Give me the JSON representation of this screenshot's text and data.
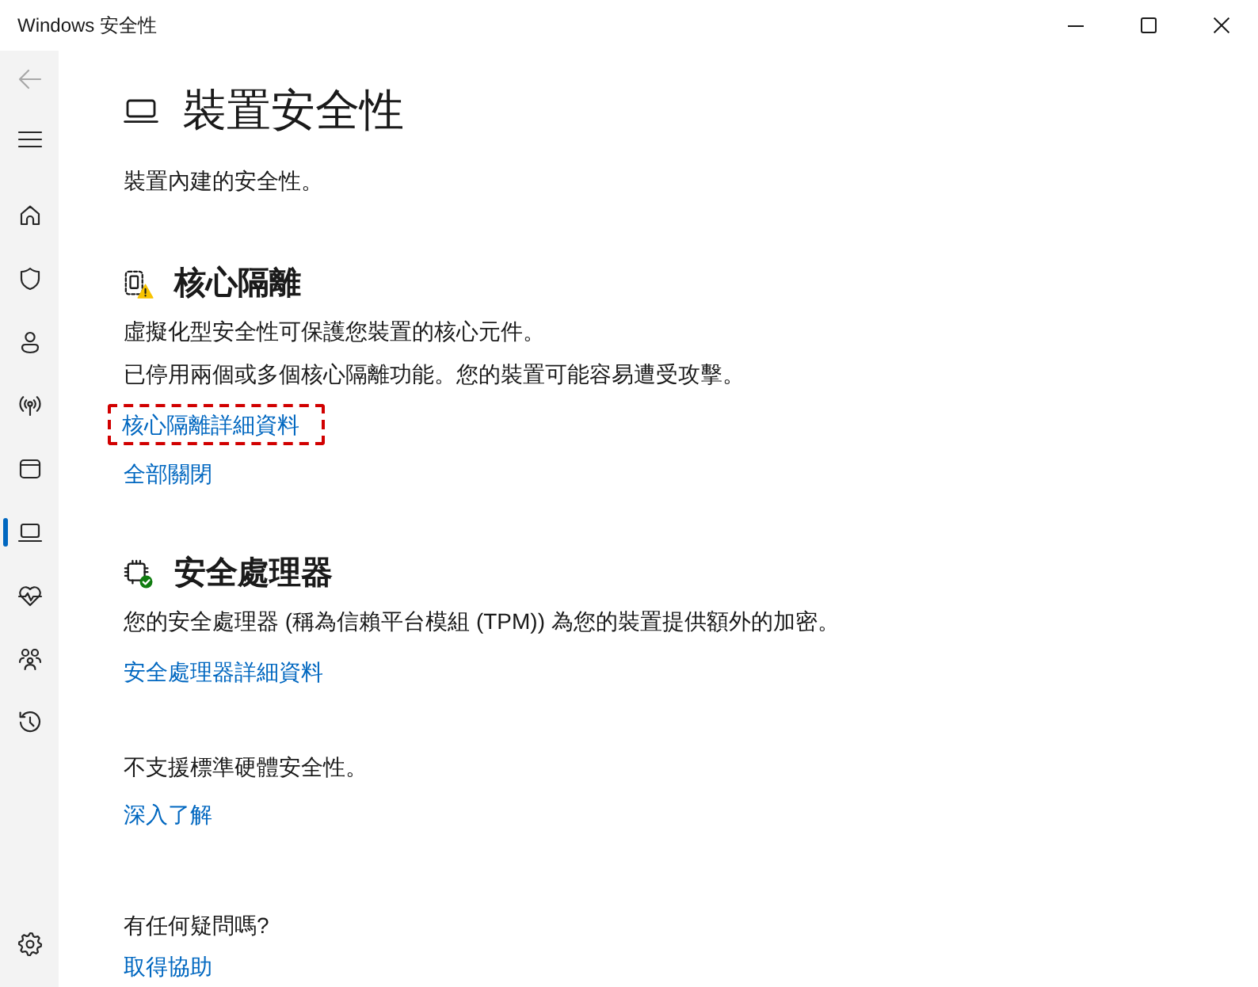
{
  "window": {
    "title": "Windows 安全性"
  },
  "sidebar": {
    "back": {
      "disabled": true
    },
    "nav_items": [
      {
        "kind": "home",
        "selected": false
      },
      {
        "kind": "shield",
        "selected": false
      },
      {
        "kind": "account",
        "selected": false
      },
      {
        "kind": "network",
        "selected": false
      },
      {
        "kind": "app",
        "selected": false
      },
      {
        "kind": "device",
        "selected": true
      },
      {
        "kind": "health",
        "selected": false
      },
      {
        "kind": "family",
        "selected": false
      },
      {
        "kind": "history",
        "selected": false
      }
    ],
    "footer_items": [
      {
        "kind": "settings",
        "selected": false
      }
    ]
  },
  "page": {
    "title": "裝置安全性",
    "subtitle": "裝置內建的安全性。"
  },
  "sections": [
    {
      "kind": "isolation",
      "warning": true,
      "title": "核心隔離",
      "lines": [
        "虛擬化型安全性可保護您裝置的核心元件。",
        "已停用兩個或多個核心隔離功能。您的裝置可能容易遭受攻擊。"
      ],
      "links": [
        {
          "text": "核心隔離詳細資料",
          "highlighted": true
        },
        {
          "text": "全部關閉",
          "highlighted": false
        }
      ]
    },
    {
      "kind": "processor",
      "warning": false,
      "title": "安全處理器",
      "lines": [
        "您的安全處理器 (稱為信賴平台模組 (TPM)) 為您的裝置提供額外的加密。"
      ],
      "links": [
        {
          "text": "安全處理器詳細資料",
          "highlighted": false
        }
      ]
    },
    {
      "kind": "plain",
      "lines": [
        "不支援標準硬體安全性。"
      ],
      "links": [
        {
          "text": "深入了解",
          "highlighted": false
        }
      ]
    }
  ],
  "help": {
    "title": "有任何疑問嗎?",
    "link": "取得協助"
  }
}
